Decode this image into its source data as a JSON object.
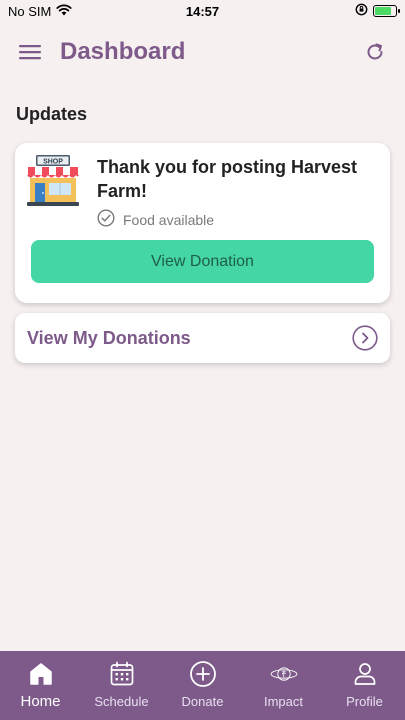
{
  "status_bar": {
    "carrier": "No SIM",
    "time": "14:57"
  },
  "header": {
    "title": "Dashboard",
    "menu_icon": "hamburger-menu-icon",
    "refresh_icon": "refresh-icon"
  },
  "updates": {
    "section_title": "Updates",
    "card": {
      "icon": "shop-icon",
      "icon_sign_text": "SHOP",
      "message": "Thank you for posting Harvest Farm!",
      "status": "Food available",
      "status_icon": "check-circle-icon",
      "button_label": "View Donation"
    }
  },
  "my_donations": {
    "label": "View My Donations",
    "icon": "chevron-right-circle-icon"
  },
  "tab_bar": {
    "active": "Home",
    "tabs": [
      {
        "label": "Home",
        "icon": "home-icon"
      },
      {
        "label": "Schedule",
        "icon": "calendar-icon"
      },
      {
        "label": "Donate",
        "icon": "plus-circle-icon"
      },
      {
        "label": "Impact",
        "icon": "planet-icon"
      },
      {
        "label": "Profile",
        "icon": "person-icon"
      }
    ]
  },
  "colors": {
    "brand_purple": "#7d5a8a",
    "accent_green": "#45d6a6",
    "background": "#f7f0f0"
  }
}
